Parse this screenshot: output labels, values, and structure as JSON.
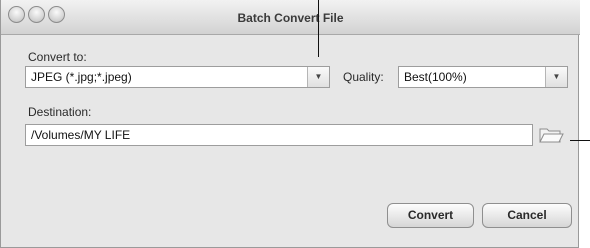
{
  "window": {
    "title": "Batch Convert File"
  },
  "convert_to": {
    "label": "Convert to:",
    "selected": "JPEG (*.jpg;*.jpeg)"
  },
  "quality": {
    "label": "Quality:",
    "selected": "Best(100%)"
  },
  "destination": {
    "label": "Destination:",
    "value": "/Volumes/MY LIFE"
  },
  "buttons": {
    "convert": "Convert",
    "cancel": "Cancel"
  },
  "icons": {
    "browse": "folder-icon",
    "dropdown": "chevron-down-icon",
    "window_controls": [
      "close-icon",
      "minimize-icon",
      "zoom-icon"
    ]
  }
}
